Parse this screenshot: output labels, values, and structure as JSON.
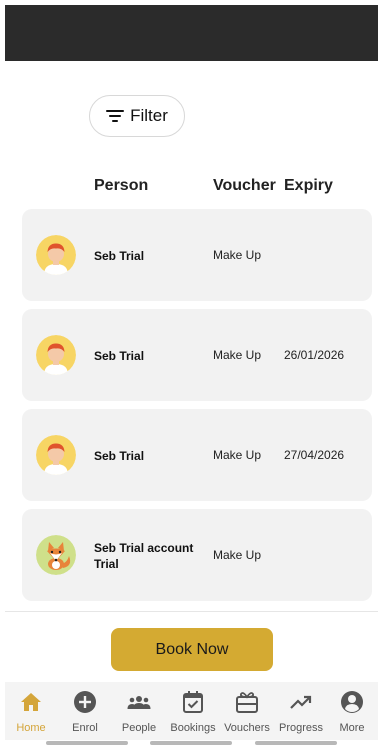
{
  "filter": {
    "label": "Filter",
    "icon": "filter-icon"
  },
  "columns": {
    "person": "Person",
    "voucher": "Voucher",
    "expiry": "Expiry"
  },
  "rows": [
    {
      "name": "Seb Trial",
      "voucher": "Make Up",
      "expiry": "",
      "avatar": "boy-avatar"
    },
    {
      "name": "Seb Trial",
      "voucher": "Make Up",
      "expiry": "26/01/2026",
      "avatar": "boy-avatar"
    },
    {
      "name": "Seb Trial",
      "voucher": "Make Up",
      "expiry": "27/04/2026",
      "avatar": "boy-avatar"
    },
    {
      "name": "Seb Trial account Trial",
      "voucher": "Make Up",
      "expiry": "",
      "avatar": "fox-avatar"
    }
  ],
  "book_now": "Book Now",
  "nav": [
    {
      "label": "Home",
      "icon": "home-icon",
      "active": true
    },
    {
      "label": "Enrol",
      "icon": "plus-circle-icon"
    },
    {
      "label": "People",
      "icon": "people-icon"
    },
    {
      "label": "Bookings",
      "icon": "calendar-check-icon"
    },
    {
      "label": "Vouchers",
      "icon": "gift-card-icon"
    },
    {
      "label": "Progress",
      "icon": "trending-up-icon"
    },
    {
      "label": "More",
      "icon": "account-circle-icon"
    }
  ],
  "colors": {
    "accent": "#d4aa32",
    "nav_active": "#d4a53a",
    "card_bg": "#f2f2f2",
    "top_bar": "#2b2b2b"
  }
}
